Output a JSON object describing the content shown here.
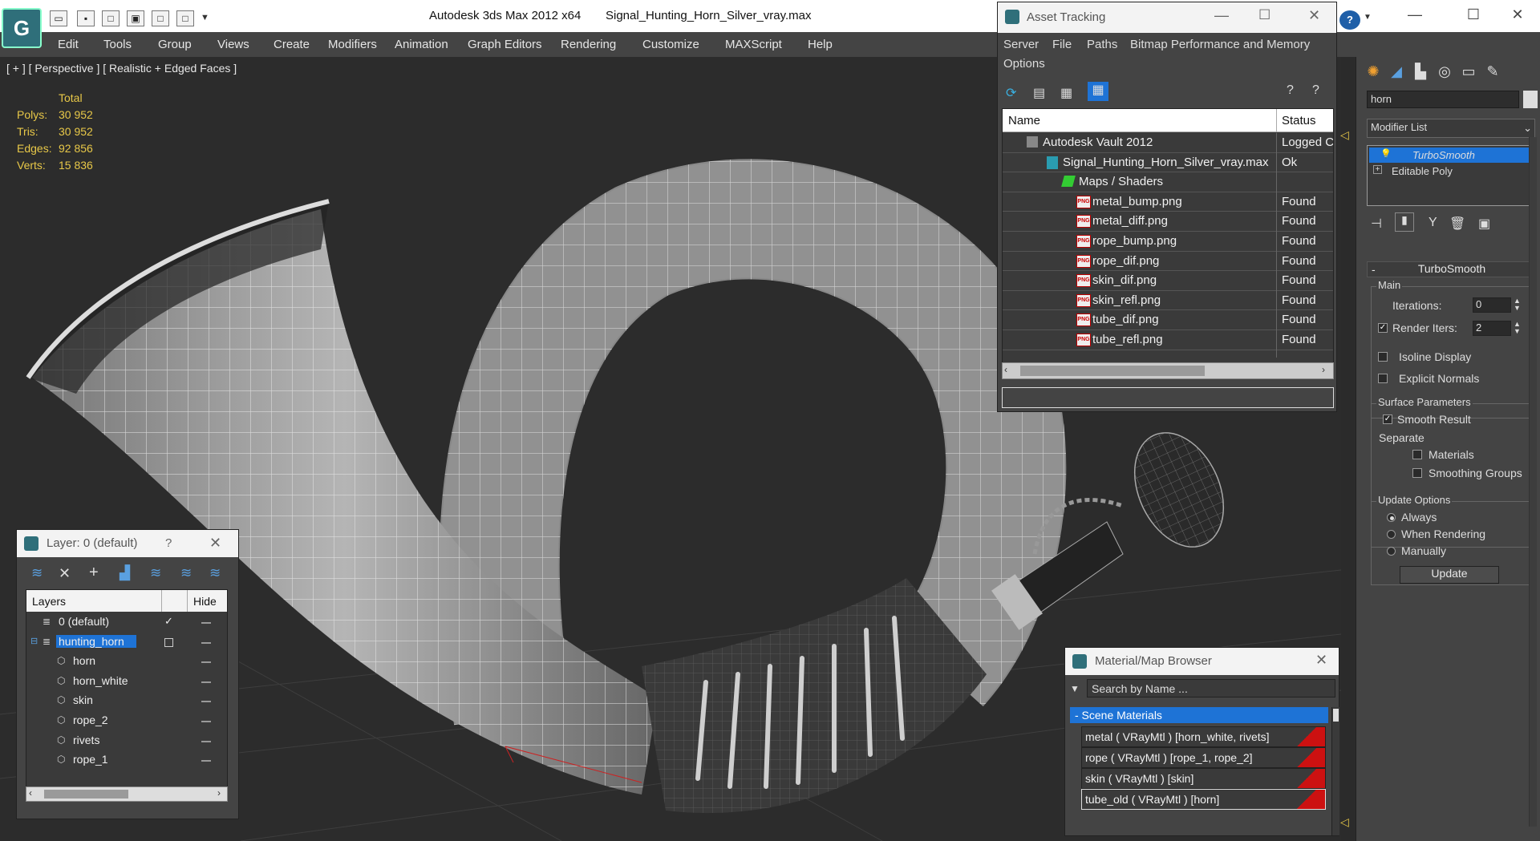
{
  "titlebar": {
    "app_title": "Autodesk 3ds Max  2012 x64",
    "file_title": "Signal_Hunting_Horn_Silver_vray.max",
    "minimize": "—",
    "maximize": "☐",
    "close": "✕",
    "help": "?"
  },
  "menubar": {
    "items": [
      "Edit",
      "Tools",
      "Group",
      "Views",
      "Create",
      "Modifiers",
      "Animation",
      "Graph Editors",
      "Rendering",
      "Customize",
      "MAXScript",
      "Help"
    ]
  },
  "viewport": {
    "label": "[ + ] [ Perspective ] [ Realistic + Edged Faces ]",
    "stats": {
      "header": "Total",
      "rows": [
        {
          "label": "Polys:",
          "value": "30 952"
        },
        {
          "label": "Tris:",
          "value": "30 952"
        },
        {
          "label": "Edges:",
          "value": "92 856"
        },
        {
          "label": "Verts:",
          "value": "15 836"
        }
      ]
    }
  },
  "asset_tracking": {
    "title": "Asset Tracking",
    "menu": [
      "Server",
      "File",
      "Paths",
      "Bitmap Performance and Memory",
      "Options"
    ],
    "columns": [
      "Name",
      "Status"
    ],
    "rows": [
      {
        "name": "Autodesk Vault 2012",
        "status": "Logged C",
        "icon": "vault-icon"
      },
      {
        "name": "Signal_Hunting_Horn_Silver_vray.max",
        "status": "Ok",
        "icon": "max-file-icon"
      },
      {
        "name": "Maps / Shaders",
        "status": "",
        "icon": "maps-icon"
      },
      {
        "name": "metal_bump.png",
        "status": "Found",
        "icon": "png-icon"
      },
      {
        "name": "metal_diff.png",
        "status": "Found",
        "icon": "png-icon"
      },
      {
        "name": "rope_bump.png",
        "status": "Found",
        "icon": "png-icon"
      },
      {
        "name": "rope_dif.png",
        "status": "Found",
        "icon": "png-icon"
      },
      {
        "name": "skin_dif.png",
        "status": "Found",
        "icon": "png-icon"
      },
      {
        "name": "skin_refl.png",
        "status": "Found",
        "icon": "png-icon"
      },
      {
        "name": "tube_dif.png",
        "status": "Found",
        "icon": "png-icon"
      },
      {
        "name": "tube_refl.png",
        "status": "Found",
        "icon": "png-icon"
      }
    ],
    "png_label": "PNG"
  },
  "layer_window": {
    "title": "Layer: 0 (default)",
    "help": "?",
    "columns": [
      "Layers",
      "Hide"
    ],
    "rows": [
      {
        "name": "0 (default)",
        "checked": true,
        "selected": false
      },
      {
        "name": "hunting_horn",
        "checked": false,
        "selected": true
      },
      {
        "name": "horn",
        "checked": false,
        "selected": false
      },
      {
        "name": "horn_white",
        "checked": false,
        "selected": false
      },
      {
        "name": "skin",
        "checked": false,
        "selected": false
      },
      {
        "name": "rope_2",
        "checked": false,
        "selected": false
      },
      {
        "name": "rivets",
        "checked": false,
        "selected": false
      },
      {
        "name": "rope_1",
        "checked": false,
        "selected": false
      }
    ]
  },
  "material_browser": {
    "title": "Material/Map Browser",
    "search_placeholder": "Search by Name ...",
    "section": "- Scene Materials",
    "materials": [
      "metal  ( VRayMtl ) [horn_white, rivets]",
      "rope  ( VRayMtl ) [rope_1, rope_2]",
      "skin  ( VRayMtl ) [skin]",
      "tube_old  ( VRayMtl ) [horn]"
    ]
  },
  "command_panel": {
    "object_name": "horn",
    "modifier_list": "Modifier List",
    "stack": [
      "TurboSmooth",
      "Editable Poly"
    ],
    "turbosmooth": {
      "title": "TurboSmooth",
      "main_label": "Main",
      "iterations_label": "Iterations:",
      "iterations_value": "0",
      "render_iters_label": "Render Iters:",
      "render_iters_value": "2",
      "isoline_label": "Isoline Display",
      "explicit_normals_label": "Explicit Normals",
      "surface_label": "Surface Parameters",
      "smooth_result_label": "Smooth Result",
      "separate_label": "Separate",
      "materials_label": "Materials",
      "smoothing_groups_label": "Smoothing Groups",
      "update_options_label": "Update Options",
      "always_label": "Always",
      "when_rendering_label": "When Rendering",
      "manually_label": "Manually",
      "update_button": "Update"
    }
  },
  "colors": {
    "selection_blue": "#1e73d6",
    "stat_yellow": "#e8c848",
    "material_red": "#cc1111"
  }
}
